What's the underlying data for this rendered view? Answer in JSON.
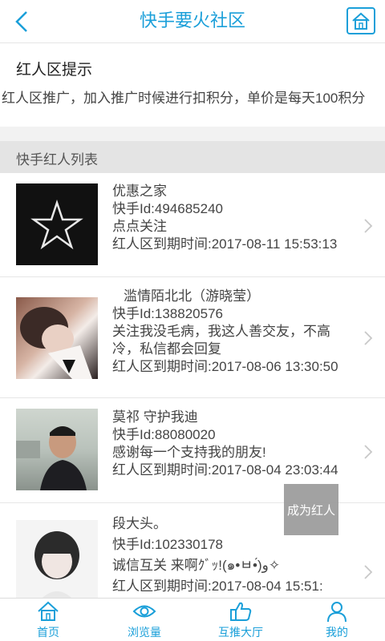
{
  "header": {
    "title": "快手要火社区"
  },
  "notice": {
    "title": "红人区提示",
    "text": "红人区推广，加入推广时候进行扣积分，单价是每天100积分"
  },
  "section": {
    "title": "快手红人列表"
  },
  "list": [
    {
      "name": "优惠之家",
      "id": "快手Id:494685240",
      "desc": "点点关注",
      "expire": "红人区到期时间:2017-08-11 15:53:13"
    },
    {
      "name": "   滥情陌北北（游晓莹）",
      "id": "快手Id:138820576",
      "desc": "关注我没毛病，我这人善交友，不高冷，私信都会回复",
      "expire": "红人区到期时间:2017-08-06 13:30:50"
    },
    {
      "name": "莫祁 守护我迪",
      "id": "快手Id:88080020",
      "desc": "感谢每一个支持我的朋友!",
      "expire": "红人区到期时间:2017-08-04 23:03:44"
    },
    {
      "name": "段大头。",
      "id": "快手Id:102330178",
      "desc": "诚信互关 来啊ｸﾞｯ!(๑•ㅂ•́)و✧",
      "expire": "红人区到期时间:2017-08-04 15:51:"
    }
  ],
  "floating": {
    "become_label": "成为红人"
  },
  "tabbar": {
    "tabs": [
      {
        "label": "首页",
        "icon": "home-icon"
      },
      {
        "label": "浏览量",
        "icon": "eye-icon"
      },
      {
        "label": "互推大厅",
        "icon": "thumbs-up-icon"
      },
      {
        "label": "我的",
        "icon": "user-icon"
      }
    ]
  },
  "colors": {
    "accent": "#1a9fd9",
    "section_bg": "#e4e4e4",
    "float_btn": "#9e9e9e"
  }
}
